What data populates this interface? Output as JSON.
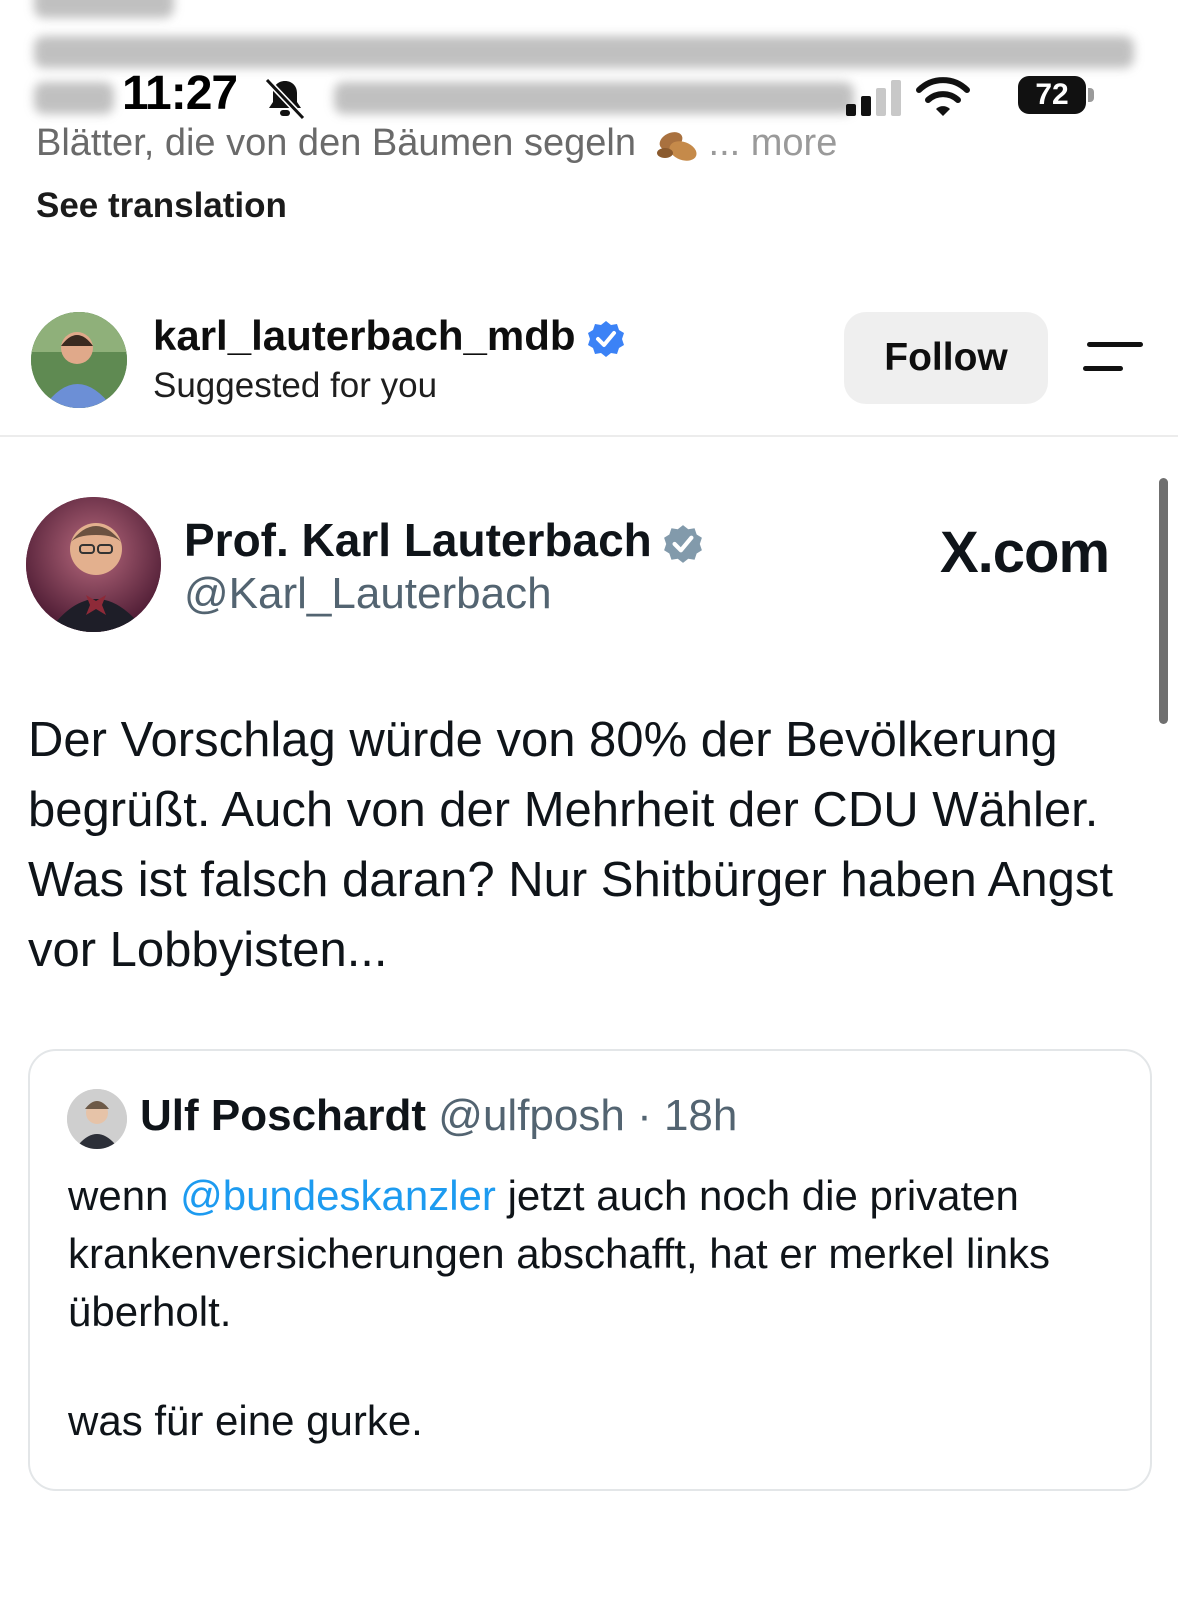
{
  "status_bar": {
    "time": "11:27",
    "battery": "72",
    "icons": [
      "bell-slash-icon",
      "cellular-signal-icon",
      "wifi-icon",
      "battery-icon"
    ]
  },
  "caption": {
    "visible_line": "Blätter, die von den Bäumen segeln",
    "more": "... more",
    "see_translation": "See translation",
    "emoji": "fallen-leaf-icon"
  },
  "post": {
    "username": "karl_lauterbach_mdb",
    "subtitle": "Suggested for you",
    "follow_label": "Follow",
    "icons": [
      "verified-badge-icon",
      "menu-icon"
    ]
  },
  "tweet": {
    "name": "Prof. Karl Lauterbach",
    "handle": "@Karl_Lauterbach",
    "source_logo": "X.com",
    "text": "Der Vorschlag würde von 80% der Bevölkerung begrüßt. Auch von der Mehrheit der CDU Wähler. Was ist falsch daran? Nur Shitbürger haben Angst vor Lobbyisten...",
    "quote": {
      "name": "Ulf Poschardt",
      "handle": "@ulfposh",
      "time": "18h",
      "text_before": "wenn ",
      "mention": "@bundeskanzler",
      "text_after": " jetzt auch noch die privaten krankenversicherungen abschafft, hat er merkel links überholt.",
      "text_second": "was für eine gurke."
    }
  },
  "colors": {
    "mention_blue": "#1d9bf0",
    "verified_blue": "#3b82f6",
    "verified_grey": "#829aab",
    "follow_bg": "#efefef"
  }
}
